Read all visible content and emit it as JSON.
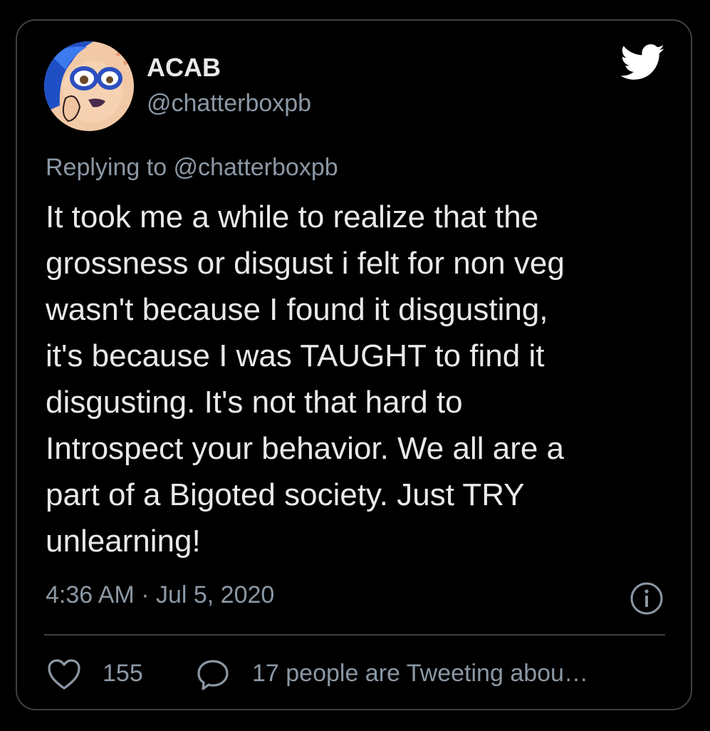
{
  "tweet": {
    "author": {
      "display_name": "ACAB",
      "handle": "@chatterboxpb",
      "avatar_icon": "pop-art-woman-avatar"
    },
    "replying_to": "Replying to @chatterboxpb",
    "text_lines": [
      "It took me a while to realize that the",
      "grossness or disgust i felt for non veg",
      "wasn't because I found it disgusting,",
      "it's because I was TAUGHT to find it",
      "disgusting. It's not that hard to",
      "Introspect your behavior. We all are a",
      "part of a Bigoted society. Just TRY",
      "unlearning!"
    ],
    "timestamp": "4:36 AM · Jul 5, 2020",
    "likes": "155",
    "tweeting_about": "17 people are Tweeting abou…"
  },
  "icons": {
    "brand": "twitter-bird-icon",
    "info": "info-icon",
    "like": "heart-icon",
    "reply": "speech-bubble-icon"
  },
  "colors": {
    "background": "#000000",
    "primary_text": "#e7e9ea",
    "secondary_text": "#8b98a5",
    "border": "#3d4147"
  }
}
